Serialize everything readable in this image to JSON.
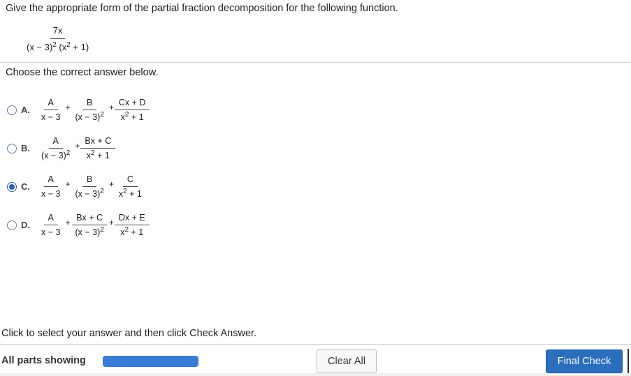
{
  "question": {
    "prompt": "Give the appropriate form of the partial fraction decomposition for the following function.",
    "function": {
      "numerator": "7x",
      "denominator": "(x − 3)² (x² + 1)"
    }
  },
  "choose_label": "Choose the correct answer below.",
  "options": [
    {
      "letter": "A.",
      "selected": false,
      "terms": [
        {
          "num": "A",
          "den": "x − 3"
        },
        {
          "num": "B",
          "den": "(x − 3)²"
        },
        {
          "num": "Cx + D",
          "den": "x² + 1"
        }
      ]
    },
    {
      "letter": "B.",
      "selected": false,
      "terms": [
        {
          "num": "A",
          "den": "(x − 3)²"
        },
        {
          "num": "Bx + C",
          "den": "x² + 1"
        }
      ]
    },
    {
      "letter": "C.",
      "selected": true,
      "terms": [
        {
          "num": "A",
          "den": "x − 3"
        },
        {
          "num": "B",
          "den": "(x − 3)²"
        },
        {
          "num": "C",
          "den": "x² + 1"
        }
      ]
    },
    {
      "letter": "D.",
      "selected": false,
      "terms": [
        {
          "num": "A",
          "den": "x − 3"
        },
        {
          "num": "Bx + C",
          "den": "(x − 3)²"
        },
        {
          "num": "Dx + E",
          "den": "x² + 1"
        }
      ]
    }
  ],
  "instruction": "Click to select your answer and then click Check Answer.",
  "footer": {
    "parts_label": "All parts showing",
    "progress_fraction": 1.0,
    "clear_label": "Clear All",
    "final_label": "Final Check"
  },
  "colors": {
    "accent": "#2a6ebd",
    "progress": "#3a7bd5",
    "radio_selected": "#2b5fb0"
  }
}
